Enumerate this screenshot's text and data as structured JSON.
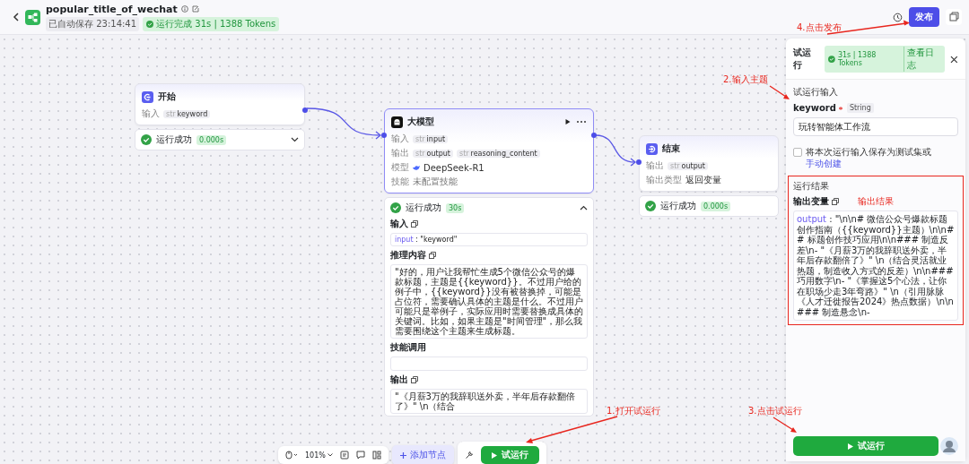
{
  "header": {
    "title": "popular_title_of_wechat",
    "saved": "已自动保存 23:14:41",
    "run_status": "运行完成 31s | 1388 Tokens",
    "publish": "发布"
  },
  "nodes": [
    {
      "kind": "start",
      "title": "开始",
      "rows": [
        {
          "label": "输入",
          "tags": [
            {
              "type": "str",
              "name": "keyword"
            }
          ]
        }
      ],
      "status": {
        "text": "运行成功",
        "time": "0.000s",
        "expanded": false
      }
    },
    {
      "kind": "llm",
      "title": "大模型",
      "selected": true,
      "rows": [
        {
          "label": "输入",
          "tags": [
            {
              "type": "str",
              "name": "input"
            }
          ]
        },
        {
          "label": "输出",
          "tags": [
            {
              "type": "str",
              "name": "output"
            },
            {
              "type": "str",
              "name": "reasoning_content"
            }
          ]
        },
        {
          "label": "模型",
          "model": "DeepSeek-R1"
        },
        {
          "label": "技能",
          "value": "未配置技能"
        }
      ],
      "status": {
        "text": "运行成功",
        "time": "30s",
        "expanded": true
      }
    },
    {
      "kind": "end",
      "title": "结束",
      "rows": [
        {
          "label": "输出",
          "tags": [
            {
              "type": "str",
              "name": "output"
            }
          ]
        },
        {
          "label": "输出类型",
          "value": "返回变量"
        }
      ],
      "status": {
        "text": "运行成功",
        "time": "0.000s",
        "expanded": false
      }
    }
  ],
  "llm_detail": {
    "input_label": "输入",
    "input_key": "input",
    "input_value": ": \"keyword\"",
    "reasoning_label": "推理内容",
    "reasoning": "\"好的，用户让我帮忙生成5个微信公众号的爆款标题，主题是{{keyword}}。不过用户给的例子中，{{keyword}}没有被替换掉，可能是占位符，需要确认具体的主题是什么。不过用户可能只是举例子，实际应用时需要替换成具体的关键词。比如，如果主题是\"时间管理\"，那么我需要围绕这个主题来生成标题。",
    "skills_label": "技能调用",
    "output_label": "输出",
    "output": "\"《月薪3万的我辞职送外卖，半年后存款翻倍了》\" \\n（结合"
  },
  "toolbar": {
    "zoom": "101%",
    "add_node": "添加节点",
    "test_run": "试运行"
  },
  "panel": {
    "title": "试运行",
    "run_info": "31s | 1388 Tokens",
    "log_link": "查看日志",
    "input_title": "试运行输入",
    "param": "keyword",
    "required": true,
    "param_type": "String",
    "value": "玩转智能体工作流",
    "save_checked": false,
    "save_text": "将本次运行输入保存为测试集或",
    "save_link": "手动创建",
    "result_title": "运行结果",
    "output_label": "输出变量",
    "output_key": "output",
    "output_value": ": \"\\n\\n# 微信公众号爆款标题创作指南（{{keyword}}主题）\\n\\n## 标题创作技巧应用\\n\\n### 制造反差\\n- \"《月薪3万的我辞职送外卖，半年后存款翻倍了》\" \\n（结合灵活就业热题，制造收入方式的反差）\\n\\n### 巧用数字\\n- \"《掌握这5个心法，让你在职场少走3年弯路》\" \\n（引用脉脉《人才迁徙报告2024》热点数据）\\n\\n### 制造悬念\\n- ",
    "run_button": "试运行"
  },
  "annotations": [
    {
      "text": "4.点击发布"
    },
    {
      "text": "2.输入主题"
    },
    {
      "text": "输出结果"
    },
    {
      "text": "1.打开试运行"
    },
    {
      "text": "3.点击试运行"
    }
  ]
}
